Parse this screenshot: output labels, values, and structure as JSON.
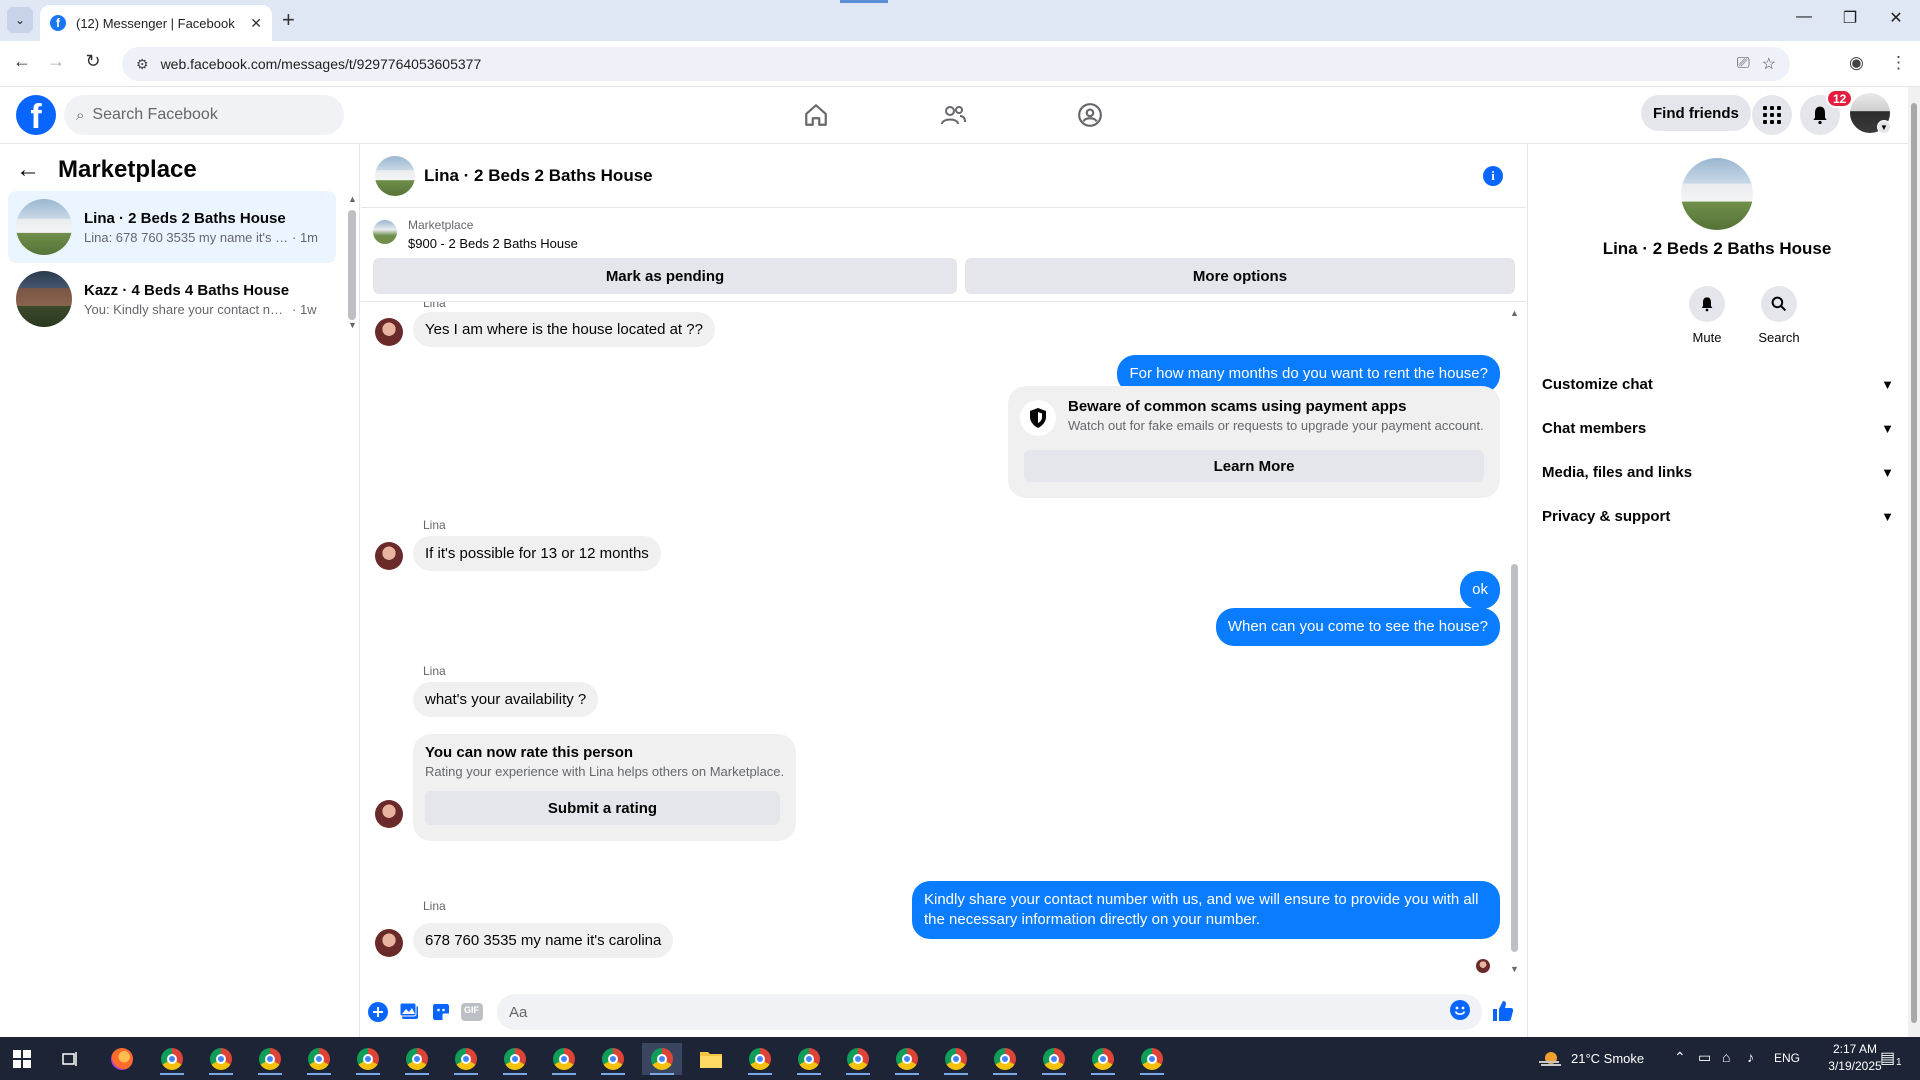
{
  "browser": {
    "tab_title": "(12) Messenger | Facebook",
    "url": "web.facebook.com/messages/t/9297764053605377"
  },
  "fb": {
    "search_placeholder": "Search Facebook",
    "find_friends": "Find friends",
    "notif_count": "12"
  },
  "left": {
    "title": "Marketplace",
    "conversations": [
      {
        "name": "Lina · 2 Beds 2 Baths House",
        "snippet": "Lina: 678 760 3535 my name it's c...",
        "time": "· 1m"
      },
      {
        "name": "Kazz · 4 Beds 4 Baths House",
        "snippet": "You: Kindly share your contact num...",
        "time": "· 1w"
      }
    ]
  },
  "chat": {
    "title": "Lina · 2 Beds 2 Baths House",
    "marketplace_label": "Marketplace",
    "listing": "$900 - 2 Beds 2 Baths House",
    "mark_pending": "Mark as pending",
    "more_options": "More options",
    "messages": {
      "sender_name": "Lina",
      "m1": "Yes I am where is the house located at ??",
      "m2": "For how many months do you want to rent the house?",
      "warn_title": "Beware of common scams using payment apps",
      "warn_sub": "Watch out for fake emails or requests to upgrade your payment account.",
      "warn_btn": "Learn More",
      "m3": "If it's possible for 13 or 12 months",
      "m4": "ok",
      "m5": "When can you come to see the house?",
      "m6": "what's your availability ?",
      "rate_title": "You can now rate this person",
      "rate_sub": "Rating your experience with Lina helps others on Marketplace.",
      "rate_btn": "Submit a rating",
      "m7": "Kindly share your contact number with us, and we will ensure to provide you with all the necessary information directly on your number.",
      "m8": "678 760 3535 my name it's carolina"
    },
    "composer_placeholder": "Aa",
    "gif_label": "GIF"
  },
  "right": {
    "title": "Lina · 2 Beds 2 Baths House",
    "mute": "Mute",
    "search": "Search",
    "sections": [
      "Customize chat",
      "Chat members",
      "Media, files and links",
      "Privacy & support"
    ]
  },
  "taskbar": {
    "weather": "21°C  Smoke",
    "lang": "ENG",
    "time": "2:17 AM",
    "date": "3/19/2025",
    "notif": "1"
  },
  "colors": {
    "fb_blue": "#0866ff",
    "bubble_out": "#0a7cff",
    "bubble_in": "#f0f0f0",
    "badge_red": "#e41e3f"
  }
}
